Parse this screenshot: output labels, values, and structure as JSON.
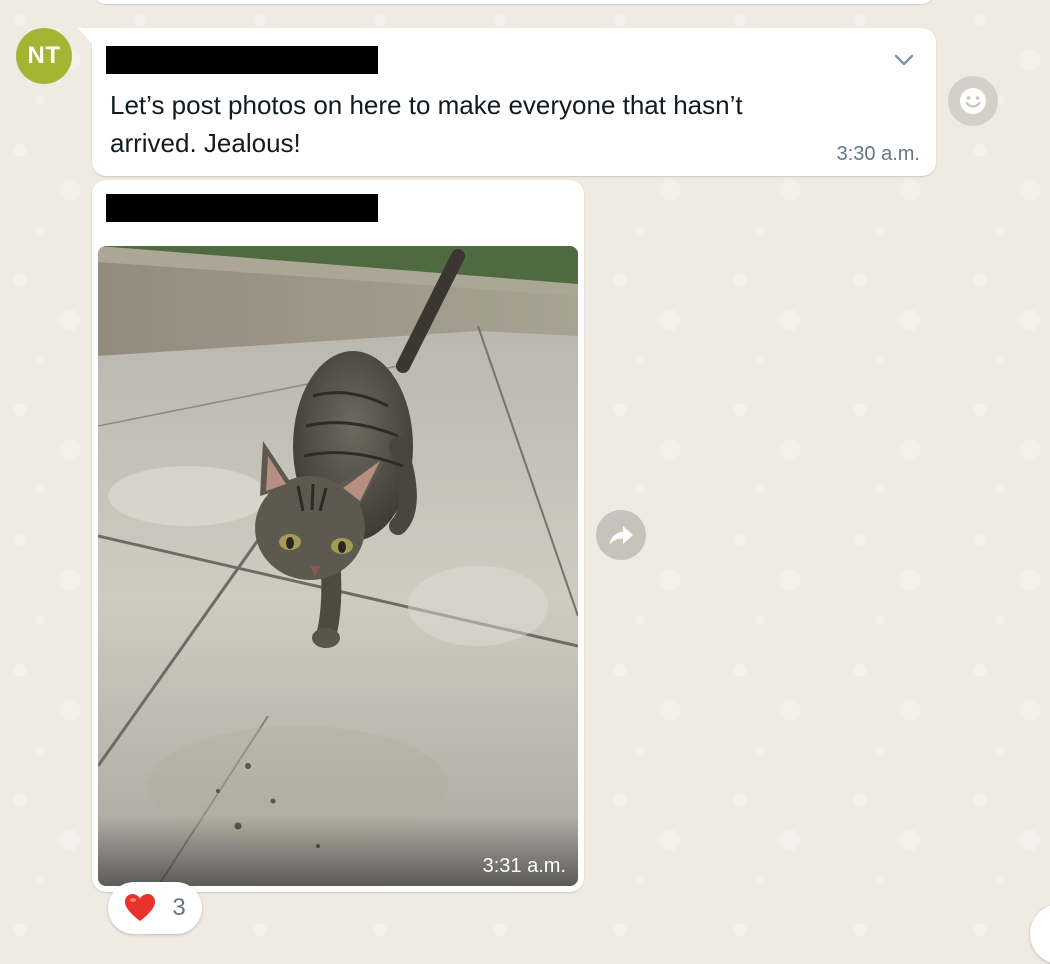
{
  "messages": [
    {
      "avatar_initials": "NT",
      "sender_redacted": true,
      "text": "Let’s post photos on here to make everyone that hasn’t arrived. Jealous!",
      "time": "3:30 a.m."
    },
    {
      "sender_redacted": true,
      "image_subject": "cat-photo",
      "time": "3:31 a.m.",
      "reaction": {
        "emoji": "heart",
        "count": "3"
      }
    }
  ],
  "icons": {
    "menu": "chevron-down-icon",
    "react": "emoji-smile-icon",
    "forward": "forward-arrow-icon",
    "reaction": "heart-icon"
  },
  "colors": {
    "avatar_bg": "#a3b532",
    "chat_bg": "#efeae2",
    "bubble_bg": "#ffffff",
    "timestamp": "#667781",
    "heart": "#e8332d"
  }
}
